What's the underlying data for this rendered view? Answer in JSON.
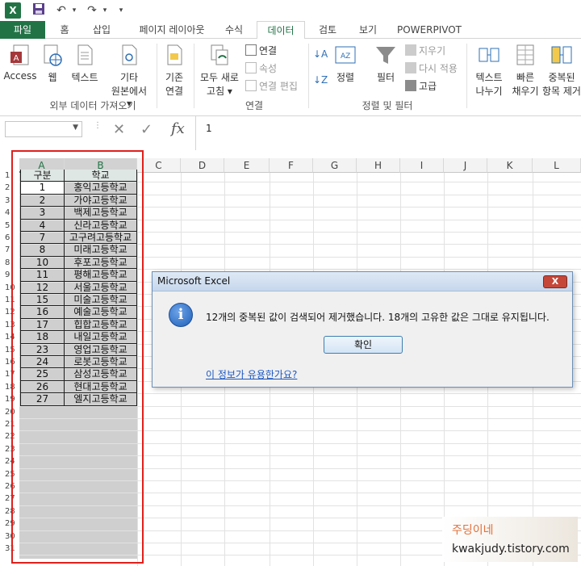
{
  "quick_access": {
    "undo": "↶",
    "redo": "↷",
    "more": "▾"
  },
  "tabs": [
    "파일",
    "홈",
    "삽입",
    "페이지 레이아웃",
    "수식",
    "데이터",
    "검토",
    "보기",
    "POWERPIVOT"
  ],
  "active_tab": "데이터",
  "ribbon": {
    "external": {
      "access": "Access",
      "web": "웹",
      "text": "텍스트",
      "other_1": "기타",
      "other_2": "원본에서 ▾",
      "group": "외부 데이터 가져오기"
    },
    "existing_1": "기존",
    "existing_2": "연결",
    "connections": {
      "refresh_1": "모두 새로",
      "refresh_2": "고침 ▾",
      "connect": "연결",
      "properties": "속성",
      "edit_links": "연결 편집",
      "group": "연결"
    },
    "sort": {
      "sort_az": "↓A",
      "sort": "정렬",
      "filter": "필터",
      "clear": "지우기",
      "reapply": "다시 적용",
      "advanced": "고급",
      "group": "정렬 및 필터"
    },
    "tools": {
      "text_to_cols_1": "텍스트",
      "text_to_cols_2": "나누기",
      "flash_1": "빠른",
      "flash_2": "채우기",
      "dupes_1": "중복된",
      "dupes_2": "항목 제거"
    }
  },
  "formula_bar": {
    "name_box": "",
    "cancel": "✕",
    "enter": "✓",
    "fx": "fx",
    "value": "1"
  },
  "columns": [
    "A",
    "B",
    "C",
    "D",
    "E",
    "F",
    "G",
    "H",
    "I",
    "J",
    "K",
    "L"
  ],
  "rows": [
    "1",
    "2",
    "3",
    "4",
    "5",
    "6",
    "7",
    "8",
    "9",
    "10",
    "11",
    "12",
    "13",
    "14",
    "15",
    "16",
    "17",
    "18",
    "19",
    "20",
    "21",
    "22",
    "23",
    "24",
    "25",
    "26",
    "27",
    "28",
    "29",
    "30",
    "31"
  ],
  "table": {
    "headers": [
      "구분",
      "학교"
    ],
    "rows": [
      [
        "1",
        "홍익고등학교"
      ],
      [
        "2",
        "가야고등학교"
      ],
      [
        "3",
        "백제고등학교"
      ],
      [
        "4",
        "신라고등학교"
      ],
      [
        "7",
        "고구려고등학교"
      ],
      [
        "8",
        "미래고등학교"
      ],
      [
        "10",
        "후포고등학교"
      ],
      [
        "11",
        "평해고등학교"
      ],
      [
        "12",
        "서울고등학교"
      ],
      [
        "15",
        "미술고등학교"
      ],
      [
        "16",
        "예술고등학교"
      ],
      [
        "17",
        "힙합고등학교"
      ],
      [
        "18",
        "내일고등학교"
      ],
      [
        "23",
        "영업고등학교"
      ],
      [
        "24",
        "로봇고등학교"
      ],
      [
        "25",
        "삼성고등학교"
      ],
      [
        "26",
        "현대고등학교"
      ],
      [
        "27",
        "엘지고등학교"
      ]
    ]
  },
  "dialog": {
    "title": "Microsoft Excel",
    "close": "X",
    "icon": "i",
    "message": "12개의 중복된 값이 검색되어 제거했습니다. 18개의 고유한 값은 그대로 유지됩니다.",
    "ok": "확인",
    "help_link": "이 정보가 유용한가요?"
  },
  "watermark": {
    "line1": "주딩이네",
    "line2": "kwakjudy.tistory.com"
  },
  "colors": {
    "excel_green": "#217346",
    "highlight_red": "#e0201c",
    "link_blue": "#1a56c2"
  }
}
